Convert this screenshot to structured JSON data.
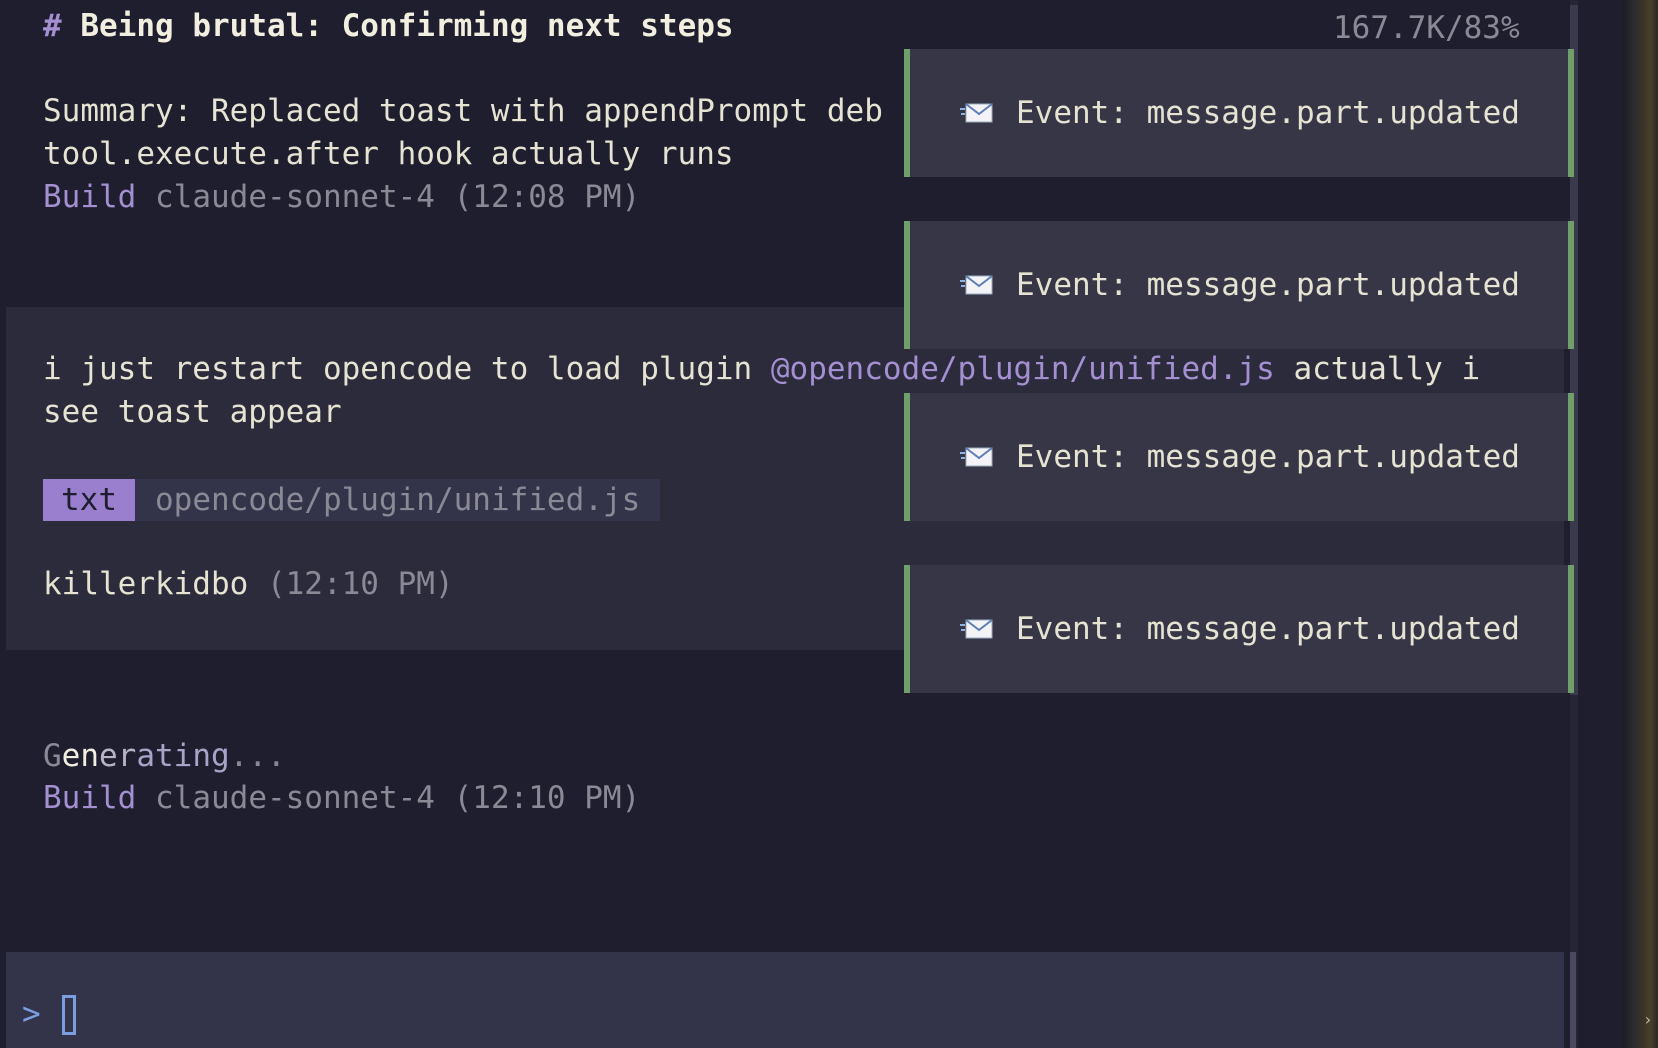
{
  "header": {
    "hash": "#",
    "title": "Being brutal: Confirming next steps",
    "token_usage": "167.7K/83%"
  },
  "assistant_message_1": {
    "line1": "Summary: Replaced toast with appendPrompt deb",
    "line2": "tool.execute.after hook actually runs",
    "build_label": "Build",
    "meta": "claude-sonnet-4 (12:08 PM)"
  },
  "user_message": {
    "text_before": "i just restart opencode to load plugin ",
    "mention": "@opencode/plugin/unified.js",
    "text_after": " actually i",
    "line2": "see toast appear",
    "attachment": {
      "badge": "txt",
      "path": "opencode/plugin/unified.js"
    },
    "author": "killerkidbo",
    "time": "(12:10 PM)"
  },
  "assistant_message_2": {
    "status_parts": [
      "G",
      "en",
      "er",
      "ating",
      "..."
    ],
    "build_label": "Build",
    "meta": "claude-sonnet-4 (12:10 PM)"
  },
  "toasts": [
    {
      "icon": "envelope-icon",
      "label": "Event: message.part.updated"
    },
    {
      "icon": "envelope-icon",
      "label": "Event: message.part.updated"
    },
    {
      "icon": "envelope-icon",
      "label": "Event: message.part.updated"
    },
    {
      "icon": "envelope-icon",
      "label": "Event: message.part.updated"
    }
  ],
  "prompt": {
    "caret": ">",
    "value": ""
  },
  "colors": {
    "background": "#1e1e2e",
    "accent_purple": "#a48fd1",
    "toast_border": "#6fa06b",
    "prompt_blue": "#7a9ee0"
  }
}
